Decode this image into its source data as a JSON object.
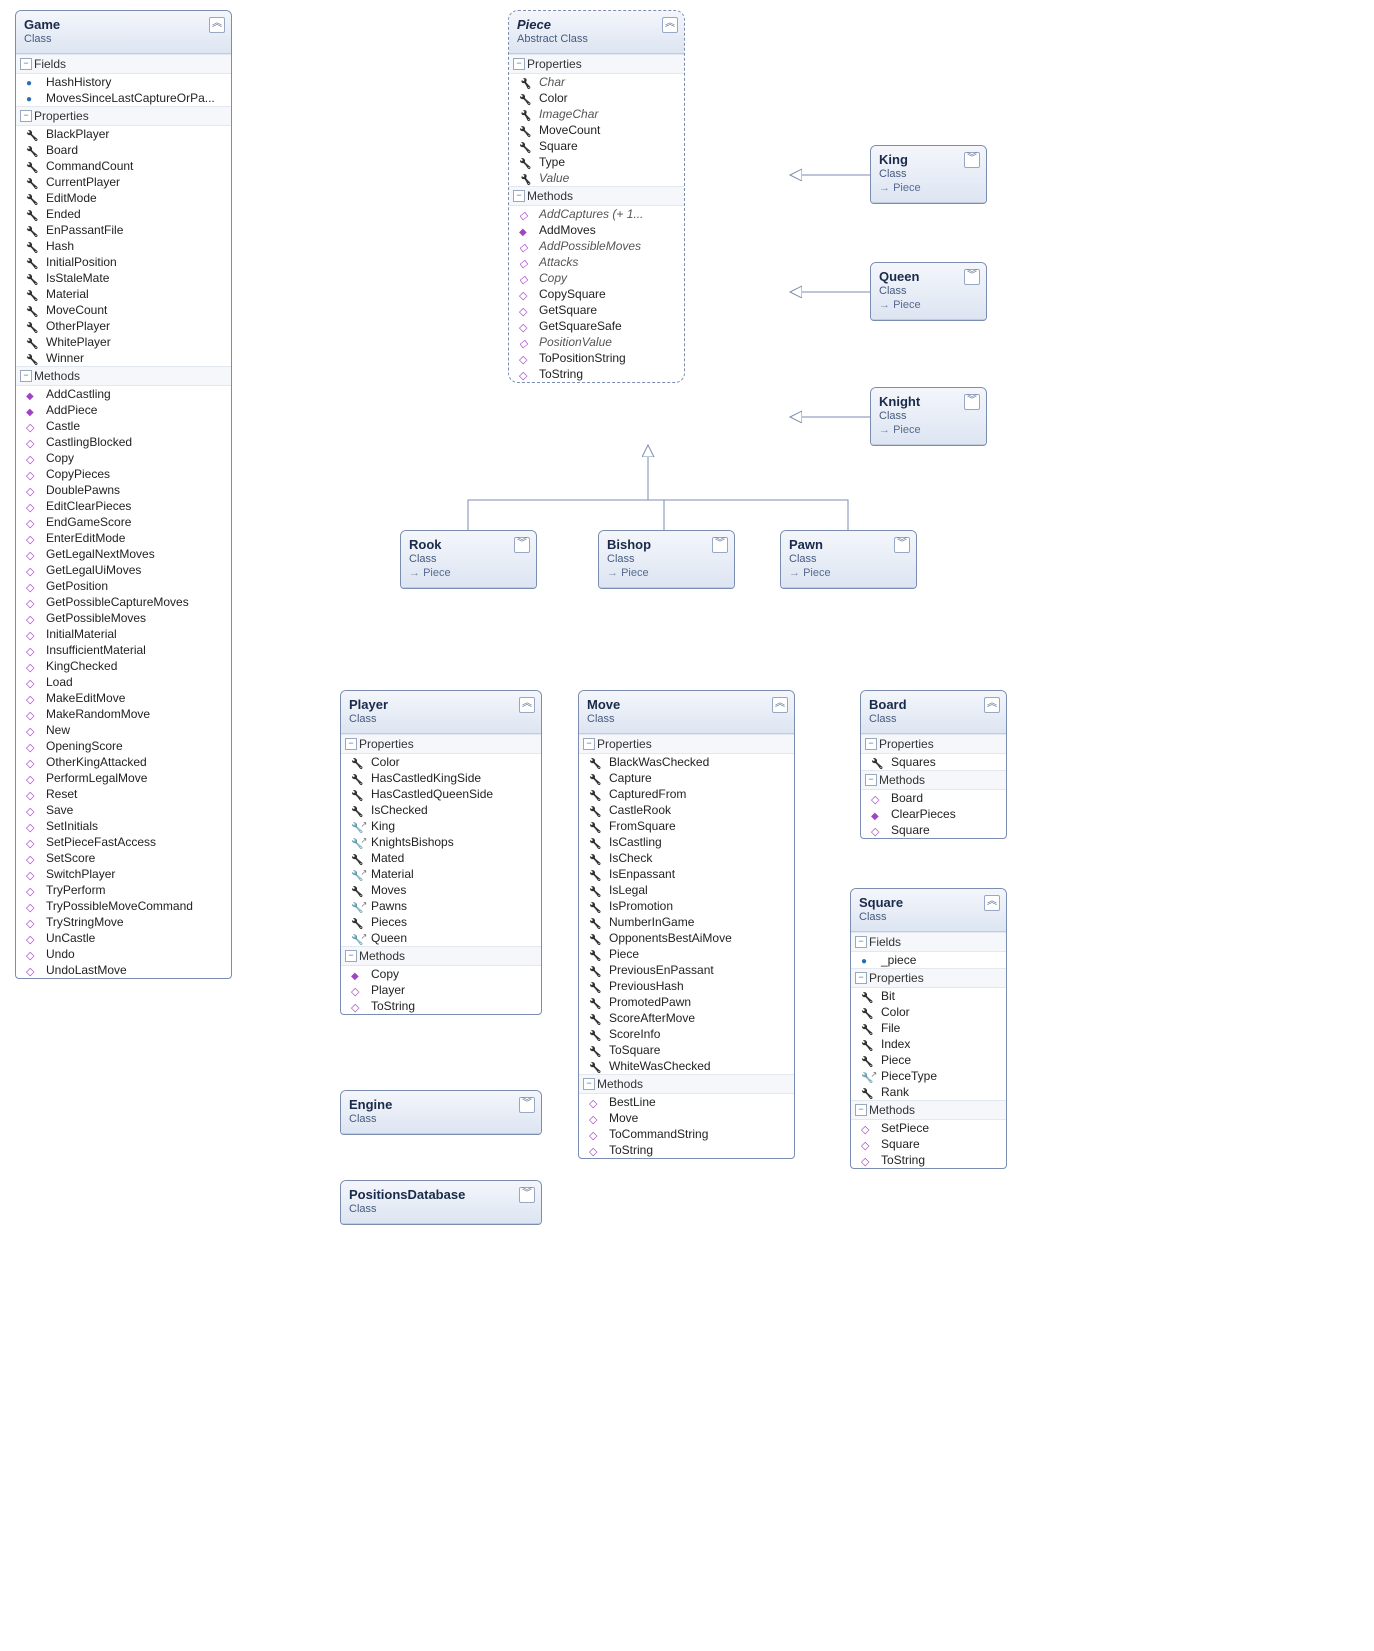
{
  "labels": {
    "fields": "Fields",
    "properties": "Properties",
    "methods": "Methods",
    "class": "Class",
    "abstract_class": "Abstract Class",
    "inherits_piece": "Piece"
  },
  "classes": {
    "game": {
      "name": "Game",
      "stereo": "class",
      "fields": [
        "HashHistory",
        "MovesSinceLastCaptureOrPa..."
      ],
      "props": [
        "BlackPlayer",
        "Board",
        "CommandCount",
        "CurrentPlayer",
        "EditMode",
        "Ended",
        "EnPassantFile",
        "Hash",
        "InitialPosition",
        "IsStaleMate",
        "Material",
        "MoveCount",
        "OtherPlayer",
        "WhitePlayer",
        "Winner"
      ],
      "methods": [
        "AddCastling",
        "AddPiece",
        "Castle",
        "CastlingBlocked",
        "Copy",
        "CopyPieces",
        "DoublePawns",
        "EditClearPieces",
        "EndGameScore",
        "EnterEditMode",
        "GetLegalNextMoves",
        "GetLegalUiMoves",
        "GetPosition",
        "GetPossibleCaptureMoves",
        "GetPossibleMoves",
        "InitialMaterial",
        "InsufficientMaterial",
        "KingChecked",
        "Load",
        "MakeEditMove",
        "MakeRandomMove",
        "New",
        "OpeningScore",
        "OtherKingAttacked",
        "PerformLegalMove",
        "Reset",
        "Save",
        "SetInitials",
        "SetPieceFastAccess",
        "SetScore",
        "SwitchPlayer",
        "TryPerform",
        "TryPossibleMoveCommand",
        "TryStringMove",
        "UnCastle",
        "Undo",
        "UndoLastMove"
      ]
    },
    "piece": {
      "name": "Piece",
      "stereo": "abstract",
      "props": [
        {
          "t": "Char",
          "i": true
        },
        {
          "t": "Color",
          "i": false
        },
        {
          "t": "ImageChar",
          "i": true
        },
        {
          "t": "MoveCount",
          "i": false
        },
        {
          "t": "Square",
          "i": false
        },
        {
          "t": "Type",
          "i": false
        },
        {
          "t": "Value",
          "i": true
        }
      ],
      "methods": [
        {
          "t": "AddCaptures (+ 1...",
          "i": true
        },
        {
          "t": "AddMoves",
          "s": true
        },
        {
          "t": "AddPossibleMoves",
          "i": true
        },
        {
          "t": "Attacks",
          "i": true
        },
        {
          "t": "Copy",
          "i": true
        },
        {
          "t": "CopySquare",
          "i": false
        },
        {
          "t": "GetSquare",
          "i": false
        },
        {
          "t": "GetSquareSafe",
          "i": false
        },
        {
          "t": "PositionValue",
          "i": true
        },
        {
          "t": "ToPositionString",
          "i": false
        },
        {
          "t": "ToString",
          "i": false
        }
      ]
    },
    "king": {
      "name": "King",
      "inherits": "Piece"
    },
    "queen": {
      "name": "Queen",
      "inherits": "Piece"
    },
    "knight": {
      "name": "Knight",
      "inherits": "Piece"
    },
    "rook": {
      "name": "Rook",
      "inherits": "Piece"
    },
    "bishop": {
      "name": "Bishop",
      "inherits": "Piece"
    },
    "pawn": {
      "name": "Pawn",
      "inherits": "Piece"
    },
    "player": {
      "name": "Player",
      "props": [
        "Color",
        "HasCastledKingSide",
        "HasCastledQueenSide",
        "IsChecked",
        "King",
        "KnightsBishops",
        "Mated",
        "Material",
        "Moves",
        "Pawns",
        "Pieces",
        "Queen"
      ],
      "props_ext": {
        "King": true,
        "KnightsBishops": true,
        "Material": true,
        "Pawns": true,
        "Queen": true
      },
      "methods": [
        {
          "t": "Copy",
          "s": true
        },
        {
          "t": "Player"
        },
        {
          "t": "ToString"
        }
      ]
    },
    "move": {
      "name": "Move",
      "props": [
        "BlackWasChecked",
        "Capture",
        "CapturedFrom",
        "CastleRook",
        "FromSquare",
        "IsCastling",
        "IsCheck",
        "IsEnpassant",
        "IsLegal",
        "IsPromotion",
        "NumberInGame",
        "OpponentsBestAiMove",
        "Piece",
        "PreviousEnPassant",
        "PreviousHash",
        "PromotedPawn",
        "ScoreAfterMove",
        "ScoreInfo",
        "ToSquare",
        "WhiteWasChecked"
      ],
      "methods": [
        "BestLine",
        "Move",
        "ToCommandString",
        "ToString"
      ]
    },
    "board": {
      "name": "Board",
      "props": [
        "Squares"
      ],
      "methods": [
        "Board",
        "ClearPieces",
        "Square"
      ]
    },
    "square": {
      "name": "Square",
      "fields": [
        "_piece"
      ],
      "props": [
        "Bit",
        "Color",
        "File",
        "Index",
        "Piece",
        "PieceType",
        "Rank"
      ],
      "props_ext": {
        "PieceType": true
      },
      "methods": [
        "SetPiece",
        "Square",
        "ToString"
      ]
    },
    "engine": {
      "name": "Engine"
    },
    "positionsdb": {
      "name": "PositionsDatabase"
    }
  }
}
